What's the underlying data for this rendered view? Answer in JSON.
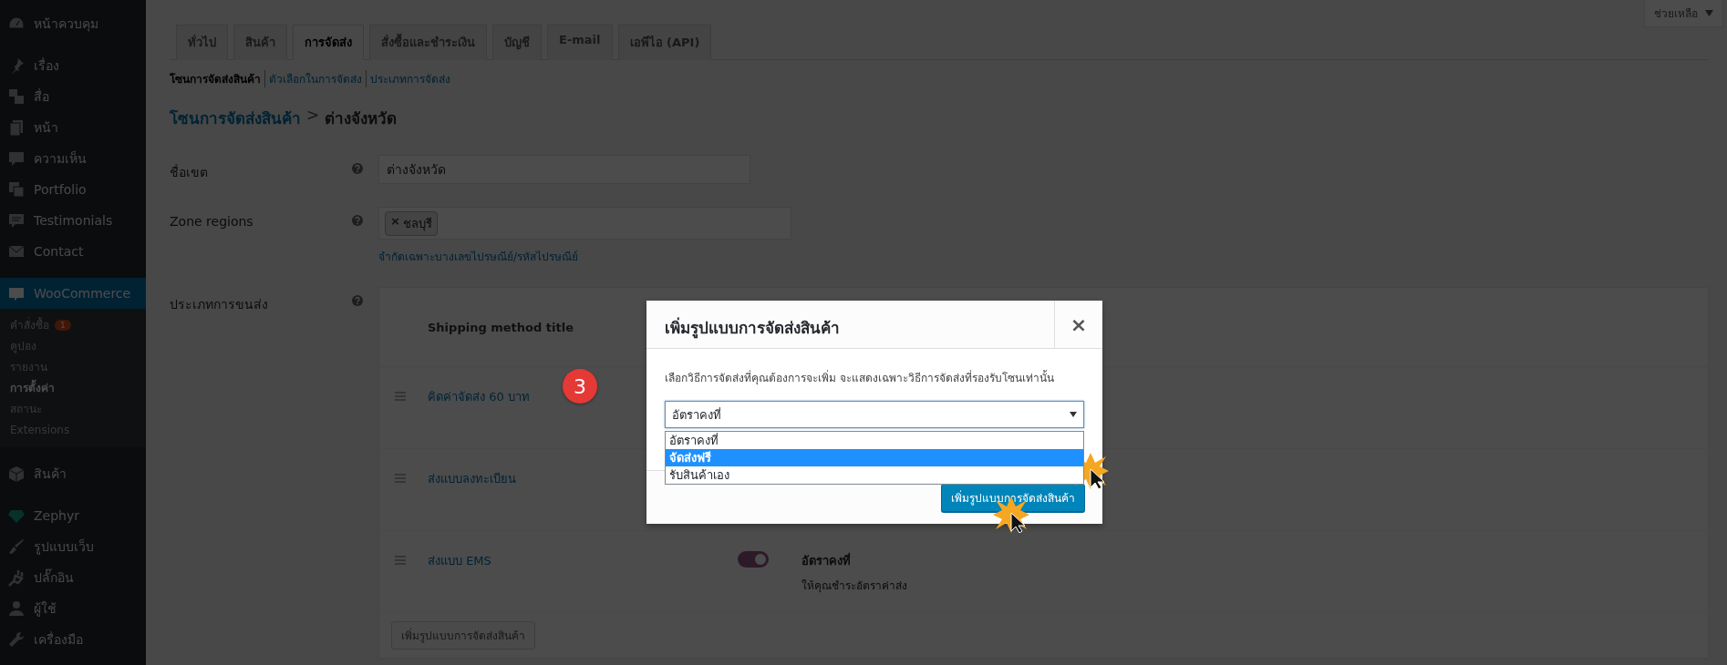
{
  "sidebar": {
    "items": [
      {
        "label": "หน้าควบคุม",
        "selected": false
      },
      {
        "label": "เรื่อง",
        "selected": false
      },
      {
        "label": "สื่อ",
        "selected": false
      },
      {
        "label": "หน้า",
        "selected": false
      },
      {
        "label": "ความเห็น",
        "selected": false
      },
      {
        "label": "Portfolio",
        "selected": false
      },
      {
        "label": "Testimonials",
        "selected": false
      },
      {
        "label": "Contact",
        "selected": false
      },
      {
        "label": "WooCommerce",
        "selected": true,
        "children": [
          {
            "label": "คำสั่งซื้อ",
            "badge": "1",
            "selected": false
          },
          {
            "label": "คูปอง",
            "selected": false
          },
          {
            "label": "รายงาน",
            "selected": false
          },
          {
            "label": "การตั้งค่า",
            "selected": true
          },
          {
            "label": "สถานะ",
            "selected": false
          },
          {
            "label": "Extensions",
            "selected": false
          }
        ]
      },
      {
        "label": "สินค้า",
        "selected": false
      },
      {
        "label": "Zephyr",
        "selected": false
      },
      {
        "label": "รูปแบบเว็บ",
        "selected": false
      },
      {
        "label": "ปลั๊กอิน",
        "selected": false
      },
      {
        "label": "ผู้ใช้",
        "selected": false
      },
      {
        "label": "เครื่องมือ",
        "selected": false
      }
    ]
  },
  "help_tab": {
    "label": "ช่วยเหลือ"
  },
  "tabs": [
    {
      "label": "ทั่วไป",
      "selected": false
    },
    {
      "label": "สินค้า",
      "selected": false
    },
    {
      "label": "การจัดส่ง",
      "selected": true
    },
    {
      "label": "สั่งซื้อและชำระเงิน",
      "selected": false
    },
    {
      "label": "บัญชี",
      "selected": false
    },
    {
      "label": "E-mail",
      "selected": false
    },
    {
      "label": "เอพีไอ (API)",
      "selected": false
    }
  ],
  "subnav": [
    {
      "label": "โซนการจัดส่งสินค้า",
      "selected": true
    },
    {
      "label": "ตัวเลือกในการจัดส่ง",
      "selected": false
    },
    {
      "label": "ประเภทการจัดส่ง",
      "selected": false
    }
  ],
  "breadcrumb": {
    "link": "โซนการจัดส่งสินค้า",
    "separator": ">",
    "current": "ต่างจังหวัด"
  },
  "form": {
    "zone_name": {
      "label": "ชื่อเขต",
      "value": "ต่างจังหวัด"
    },
    "zone_regions": {
      "label": "Zone regions",
      "tags": [
        {
          "remove": "×",
          "label": "ชลบุรี"
        }
      ],
      "link": "จำกัดเฉพาะบางเลขไปรษณีย์/รหัสไปรษณีย์"
    },
    "shipping_methods": {
      "label": "ประเภทการขนส่ง",
      "columns": [
        "Shipping method title"
      ],
      "rows": [
        {
          "title": "คิดค่าจัดส่ง 60 บาท"
        },
        {
          "title": "ส่งแบบลงทะเบียน"
        },
        {
          "title": "ส่งแบบ EMS",
          "enabled": true,
          "method": "อัตราคงที่",
          "description": "ให้คุณชำระอัตราค่าส่ง"
        }
      ],
      "add_button": "เพิ่มรูปแบบการจัดส่งสินค้า"
    }
  },
  "step_badge": "3",
  "modal": {
    "title": "เพิ่มรูปแบบการจัดส่งสินค้า",
    "close": "×",
    "description": "เลือกวิธีการจัดส่งที่คุณต้องการจะเพิ่ม จะแสดงเฉพาะวิธีการจัดส่งที่รองรับโซนเท่านั้น",
    "select": {
      "value": "อัตราคงที่",
      "options": [
        {
          "label": "อัตราคงที่",
          "highlighted": false
        },
        {
          "label": "จัดส่งฟรี",
          "highlighted": true
        },
        {
          "label": "รับสินค้าเอง",
          "highlighted": false
        }
      ]
    },
    "button": "เพิ่มรูปแบบการจัดส่งสินค้า"
  }
}
